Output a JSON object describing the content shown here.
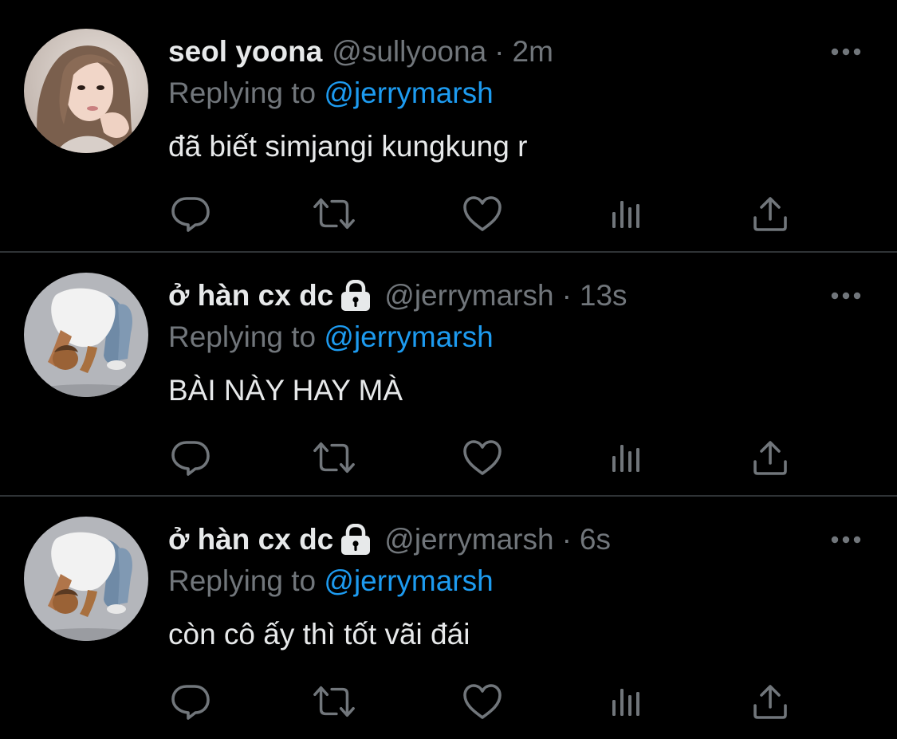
{
  "colors": {
    "background": "#000000",
    "text": "#e7e9ea",
    "muted": "#71767b",
    "link": "#1d9bf0",
    "divider": "#2f3336"
  },
  "action_icons": [
    "reply-icon",
    "retweet-icon",
    "like-icon",
    "analytics-icon",
    "share-icon"
  ],
  "tweets": [
    {
      "name": "seol yoona",
      "protected": false,
      "handle": "@sullyoona",
      "separator": "·",
      "time": "2m",
      "reply_prefix": "Replying to",
      "reply_target": "@jerrymarsh",
      "text": "đã biết simjangi kungkung r",
      "avatar": "avatar-photo-woman"
    },
    {
      "name": "ở hàn cx dc",
      "protected": true,
      "handle": "@jerrymarsh",
      "separator": "·",
      "time": "13s",
      "reply_prefix": "Replying to",
      "reply_target": "@jerrymarsh",
      "text": "BÀI NÀY HAY MÀ",
      "avatar": "avatar-kneeling-figure"
    },
    {
      "name": "ở hàn cx dc",
      "protected": true,
      "handle": "@jerrymarsh",
      "separator": "·",
      "time": "6s",
      "reply_prefix": "Replying to",
      "reply_target": "@jerrymarsh",
      "text": "còn cô ấy thì tốt vãi đái",
      "avatar": "avatar-kneeling-figure"
    }
  ]
}
